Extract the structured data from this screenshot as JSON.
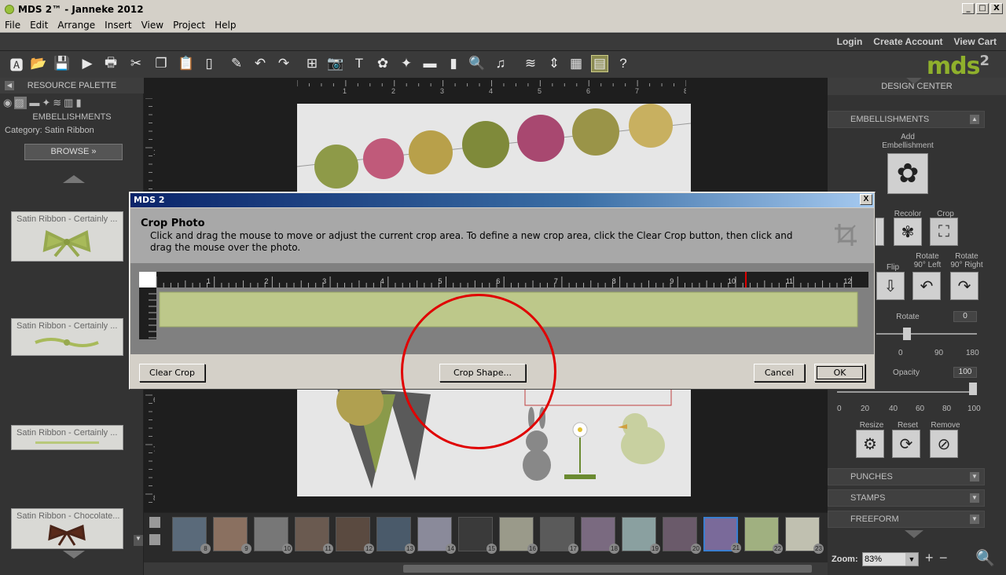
{
  "window": {
    "title": "MDS 2™ - Janneke 2012",
    "min": "_",
    "max": "□",
    "close": "X"
  },
  "menu": [
    "File",
    "Edit",
    "Arrange",
    "Insert",
    "View",
    "Project",
    "Help"
  ],
  "toplinks": [
    "Login",
    "Create Account",
    "View Cart"
  ],
  "brand": {
    "name": "mds",
    "sup": "2",
    "color": "#8fb02c"
  },
  "toolbar": [
    {
      "icon": "text-box-icon",
      "glyph": "🅰"
    },
    {
      "icon": "open-folder-icon",
      "glyph": "📂"
    },
    {
      "icon": "save-icon",
      "glyph": "💾"
    },
    {
      "icon": "preview-icon",
      "glyph": "▶"
    },
    {
      "icon": "print-icon",
      "glyph": "🖶"
    },
    {
      "icon": "cut-icon",
      "glyph": "✂"
    },
    {
      "icon": "copy-icon",
      "glyph": "❐"
    },
    {
      "icon": "paste-icon",
      "glyph": "📋"
    },
    {
      "icon": "clipboard-icon",
      "glyph": "▯"
    },
    {
      "icon": "format-painter-icon",
      "glyph": "✎"
    },
    {
      "icon": "undo-icon",
      "glyph": "↶"
    },
    {
      "icon": "redo-icon",
      "glyph": "↷"
    },
    {
      "icon": "add-page-icon",
      "glyph": "⊞"
    },
    {
      "icon": "camera-icon",
      "glyph": "📷"
    },
    {
      "icon": "text-icon",
      "glyph": "T"
    },
    {
      "icon": "flower-icon",
      "glyph": "✿"
    },
    {
      "icon": "shapes-icon",
      "glyph": "✦"
    },
    {
      "icon": "ribbon-icon",
      "glyph": "▬"
    },
    {
      "icon": "column-icon",
      "glyph": "▮"
    },
    {
      "icon": "zoom-search-icon",
      "glyph": "🔍"
    },
    {
      "icon": "music-icon",
      "glyph": "♫"
    },
    {
      "icon": "layers-icon",
      "glyph": "≋"
    },
    {
      "icon": "align-icon",
      "glyph": "⇕"
    },
    {
      "icon": "grid-icon",
      "glyph": "▦"
    },
    {
      "icon": "ruler-icon",
      "glyph": "▤"
    },
    {
      "icon": "help-icon",
      "glyph": "?"
    }
  ],
  "left_panel": {
    "title": "RESOURCE PALETTE",
    "section": "EMBELLISHMENTS",
    "category": "Category: Satin Ribbon",
    "browse": "BROWSE  »",
    "items": [
      {
        "label": "Satin Ribbon - Certainly ..."
      },
      {
        "label": "Satin Ribbon - Certainly ..."
      },
      {
        "label": "Satin Ribbon - Certainly ..."
      },
      {
        "label": "Satin Ribbon - Chocolate..."
      }
    ]
  },
  "ruler_marks": [
    "1",
    "2",
    "3",
    "4",
    "5",
    "6",
    "7",
    "8"
  ],
  "vruler_marks": [
    "1",
    "6",
    "7",
    "8"
  ],
  "right_panel": {
    "title": "DESIGN CENTER",
    "sections": [
      "EMBELLISHMENTS",
      "PUNCHES",
      "STAMPS",
      "FREEFORM"
    ],
    "add_label": "Add\nEmbellishment",
    "recolor": "Recolor",
    "crop": "Crop",
    "shadow_fragment": "w",
    "flip": "Flip",
    "rotate_left": "Rotate\n90° Left",
    "rotate_right": "Rotate\n90° Right",
    "rotate_label": "Rotate",
    "rotate_value": "0",
    "rotate_ticks": [
      "0",
      "90",
      "180"
    ],
    "opacity_label": "Opacity",
    "opacity_value": "100",
    "opacity_ticks": [
      "0",
      "20",
      "40",
      "60",
      "80",
      "100"
    ],
    "resize": "Resize",
    "reset": "Reset",
    "remove": "Remove",
    "zoom_label": "Zoom:",
    "zoom_value": "83%"
  },
  "filmstrip": [
    "8",
    "9",
    "10",
    "11",
    "12",
    "13",
    "14",
    "15",
    "16",
    "17",
    "18",
    "19",
    "20",
    "21",
    "22",
    "23"
  ],
  "dialog": {
    "title": "MDS 2",
    "close": "X",
    "heading": "Crop Photo",
    "description": "Click and drag the mouse to move or adjust the current crop area. To define a new crop area, click the Clear Crop button, then click and drag the mouse over the photo.",
    "ruler_marks": [
      "1",
      "2",
      "3",
      "4",
      "5",
      "6",
      "7",
      "8",
      "9",
      "10",
      "11",
      "12"
    ],
    "clear_crop": "Clear Crop",
    "crop_shape": "Crop Shape...",
    "cancel": "Cancel",
    "ok": "OK"
  }
}
